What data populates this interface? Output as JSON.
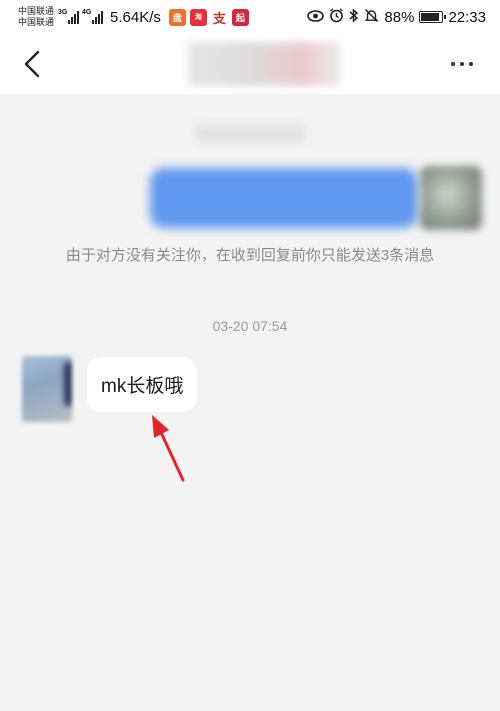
{
  "status_bar": {
    "carrier_1": "中国联通",
    "carrier_2": "中国联通",
    "signal_1_tag": "3G",
    "signal_2_tag": "4G",
    "speed": "5.64K/s",
    "battery": "88%",
    "time": "22:33",
    "icons": [
      "eye-icon",
      "alarm-icon",
      "bluetooth-icon",
      "mute-icon"
    ],
    "app_icons": [
      {
        "name": "app-icon-1",
        "label": "盘",
        "color": "#f0712b"
      },
      {
        "name": "app-icon-2",
        "label": "淘",
        "color": "#e8303d"
      },
      {
        "name": "app-icon-3",
        "label": "支",
        "color": "#ffffff"
      },
      {
        "name": "app-icon-4",
        "label": "起",
        "color": "#d7263d"
      }
    ]
  },
  "nav": {
    "back_label": "back",
    "more_label": "more"
  },
  "chat": {
    "notice": "由于对方没有关注你，在收到回复前你只能发送3条消息",
    "timestamp": "03-20 07:54",
    "received_message": "mk长板哦"
  },
  "colors": {
    "sent_bubble": "#5f97ee",
    "annotation_arrow": "#e0262a",
    "background": "#f3f3f3"
  }
}
